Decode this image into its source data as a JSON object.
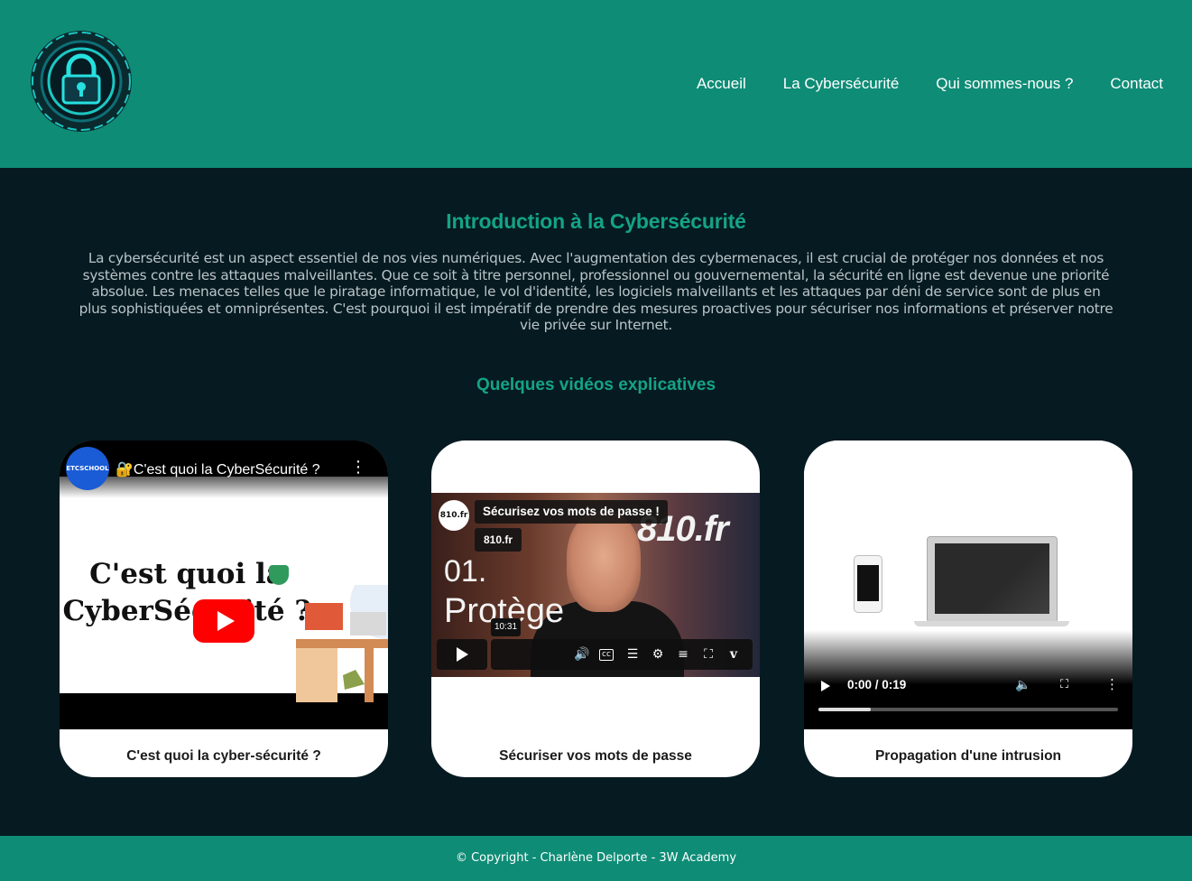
{
  "nav": {
    "items": [
      "Accueil",
      "La Cybersécurité",
      "Qui sommes-nous ?",
      "Contact"
    ]
  },
  "main": {
    "title": "Introduction à la Cybersécurité",
    "intro": "La cybersécurité est un aspect essentiel de nos vies numériques. Avec l'augmentation des cybermenaces, il est crucial de protéger nos données et nos systèmes contre les attaques malveillantes. Que ce soit à titre personnel, professionnel ou gouvernemental, la sécurité en ligne est devenue une priorité absolue. Les menaces telles que le piratage informatique, le vol d'identité, les logiciels malveillants et les attaques par déni de service sont de plus en plus sophistiquées et omniprésentes. C'est pourquoi il est impératif de prendre des mesures proactives pour sécuriser nos informations et préserver notre vie privée sur Internet.",
    "videos_title": "Quelques vidéos explicatives"
  },
  "videos": [
    {
      "caption": "C'est quoi la cyber-sécurité ?",
      "player": "youtube",
      "channel_badge": "ETCSCHOOL",
      "video_title": "🔐C'est quoi la CyberSécurité ?",
      "thumbnail_text": "C'est quoi la CyberSécurité ?"
    },
    {
      "caption": "Sécuriser vos mots de passe",
      "player": "vimeo",
      "channel_badge": "810.fr",
      "video_title": "Sécurisez vos mots de passe !",
      "owner": "810.fr",
      "brand": "810.fr",
      "number": "01.",
      "word": "Protège",
      "duration": "10:31"
    },
    {
      "caption": "Propagation d'une intrusion",
      "player": "html5",
      "time": "0:00 / 0:19",
      "progress": 0.17
    }
  ],
  "footer": {
    "copyright": "© Copyright - Charlène Delporte - 3W Academy"
  },
  "colors": {
    "header_bg": "#0e8c76",
    "page_bg": "#061a21",
    "accent": "#14a386",
    "youtube_red": "#ff0000"
  }
}
